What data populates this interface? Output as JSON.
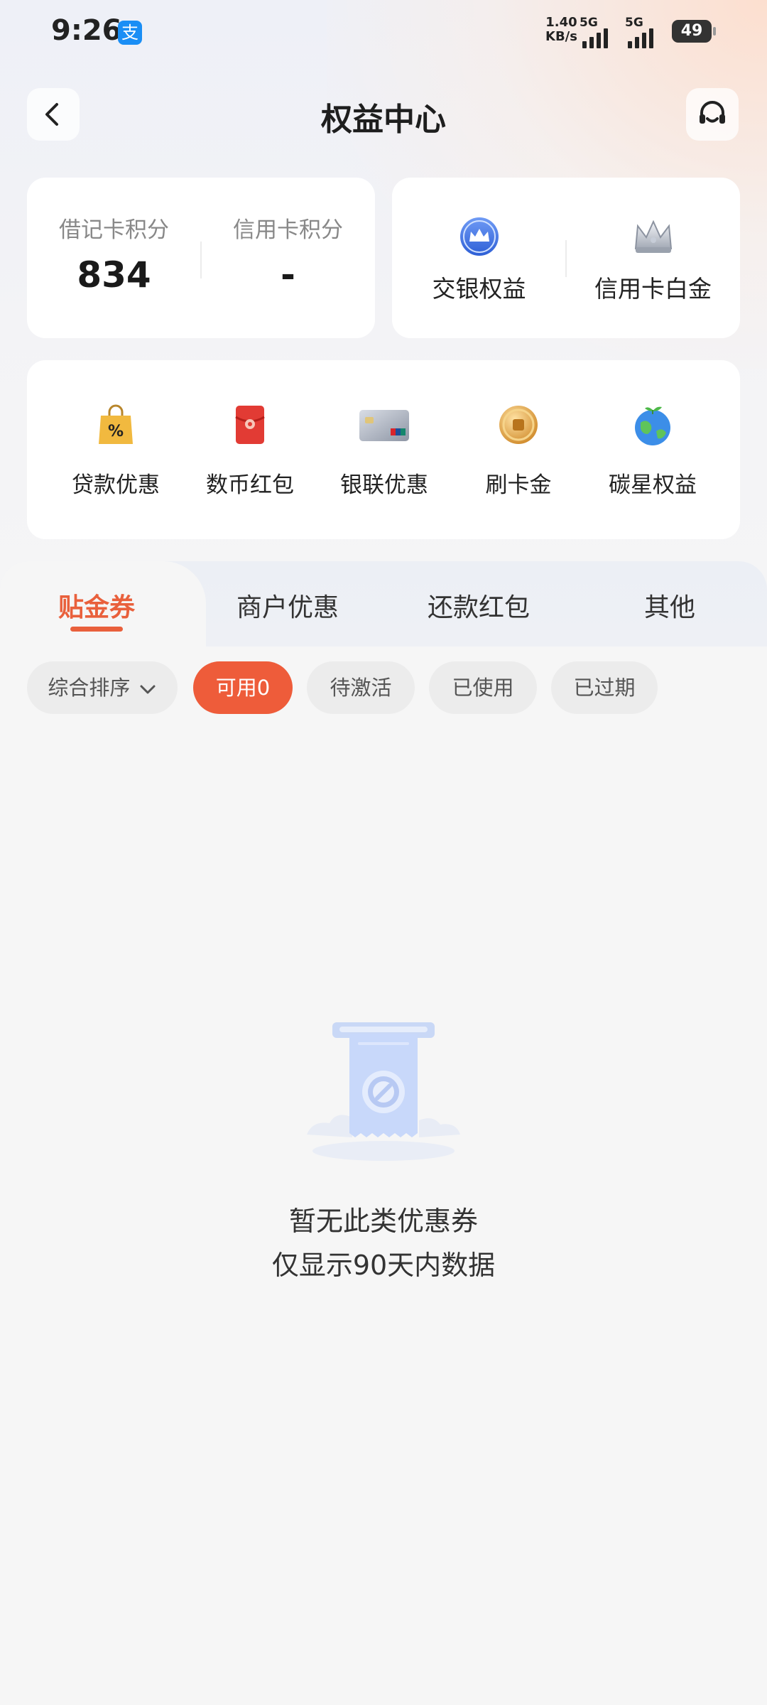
{
  "status_bar": {
    "time": "9:26",
    "app_badge": "支",
    "net_speed_value": "1.40",
    "net_speed_unit": "KB/s",
    "signal_1": "5G",
    "signal_2": "5G",
    "battery": "49"
  },
  "header": {
    "title": "权益中心",
    "back_icon": "chevron-left-icon",
    "service_icon": "headset-icon"
  },
  "points": {
    "debit_label": "借记卡积分",
    "debit_value": "834",
    "credit_label": "信用卡积分",
    "credit_value": "-"
  },
  "benefits": [
    {
      "label": "交银权益",
      "icon": "crown-badge-icon"
    },
    {
      "label": "信用卡白金",
      "icon": "silver-crown-icon"
    }
  ],
  "services": [
    {
      "label": "贷款优惠",
      "icon": "shopping-bag-percent-icon"
    },
    {
      "label": "数币红包",
      "icon": "red-envelope-icon"
    },
    {
      "label": "银联优惠",
      "icon": "unionpay-card-icon"
    },
    {
      "label": "刷卡金",
      "icon": "gold-coin-icon"
    },
    {
      "label": "碳星权益",
      "icon": "earth-plant-icon"
    }
  ],
  "tabs": [
    {
      "label": "贴金券",
      "active": true
    },
    {
      "label": "商户优惠",
      "active": false
    },
    {
      "label": "还款红包",
      "active": false
    },
    {
      "label": "其他",
      "active": false
    }
  ],
  "filters": {
    "sort_label": "综合排序",
    "chips": [
      {
        "label": "可用0",
        "active": true
      },
      {
        "label": "待激活",
        "active": false
      },
      {
        "label": "已使用",
        "active": false
      },
      {
        "label": "已过期",
        "active": false
      }
    ]
  },
  "empty_state": {
    "line1": "暂无此类优惠券",
    "line2": "仅显示90天内数据",
    "icon": "empty-coupon-icon"
  },
  "colors": {
    "accent": "#ee5c3a",
    "tab_active": "#e9603c",
    "background": "#f6f6f6"
  }
}
